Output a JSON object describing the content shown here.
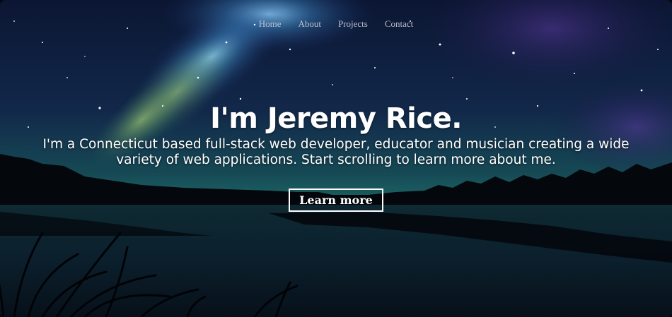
{
  "nav": {
    "items": [
      {
        "label": "Home"
      },
      {
        "label": "About"
      },
      {
        "label": "Projects"
      },
      {
        "label": "Contact"
      }
    ]
  },
  "hero": {
    "title": "I'm Jeremy Rice.",
    "subtitle": "I'm a Connecticut based full-stack web developer, educator and musician creating a wide variety of web applications. Start scrolling to learn more about me.",
    "cta_label": "Learn more"
  },
  "background": {
    "scene": "night-sky-lake-illustration",
    "colors": {
      "sky_top": "#0d1a3a",
      "galaxy": "#3a7fb0",
      "horizon_glow": "#1f6f6a",
      "silhouette": "#04060b",
      "water": "#0a1620"
    }
  }
}
